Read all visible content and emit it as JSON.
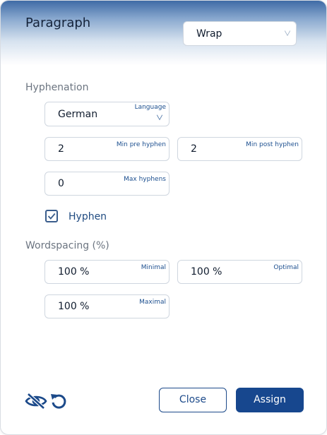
{
  "dialog": {
    "title": "Paragraph"
  },
  "mode_select": {
    "value": "Wrap"
  },
  "hyphenation": {
    "heading": "Hyphenation",
    "language": {
      "label": "Language",
      "value": "German"
    },
    "min_pre": {
      "label": "Min pre hyphen",
      "value": "2"
    },
    "min_post": {
      "label": "Min post hyphen",
      "value": "2"
    },
    "max_hyphens": {
      "label": "Max hyphens",
      "value": "0"
    },
    "hyphen_checkbox": {
      "label": "Hyphen",
      "checked": true
    }
  },
  "wordspacing": {
    "heading": "Wordspacing (%)",
    "minimal": {
      "label": "Minimal",
      "value": "100 %"
    },
    "optimal": {
      "label": "Optimal",
      "value": "100 %"
    },
    "maximal": {
      "label": "Maximal",
      "value": "100 %"
    }
  },
  "footer": {
    "visibility_icon": "eye-off-icon",
    "reset_icon": "undo-icon",
    "close_label": "Close",
    "assign_label": "Assign"
  },
  "colors": {
    "primary": "#17478e",
    "label_blue": "#1c4f8f",
    "header_top": "#3f6ba6"
  }
}
